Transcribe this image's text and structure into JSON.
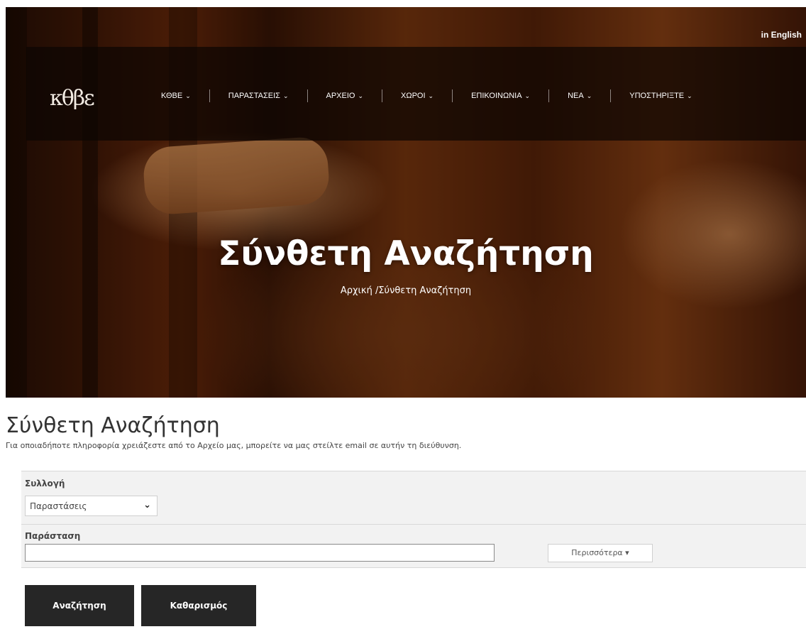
{
  "header": {
    "language_link": "in English",
    "logo_text": "κθβε",
    "nav": [
      {
        "label": "ΚΘΒΕ",
        "chevron": "⌄"
      },
      {
        "label": "ΠΑΡΑΣΤΑΣΕΙΣ",
        "chevron": "⌄"
      },
      {
        "label": "ΑΡΧΕΙΟ",
        "chevron": "⌄"
      },
      {
        "label": "ΧΩΡΟΙ",
        "chevron": "⌄"
      },
      {
        "label": "ΕΠΙΚΟΙΝΩΝΙΑ",
        "chevron": "⌄"
      },
      {
        "label": "ΝΕΑ",
        "chevron": "⌄"
      },
      {
        "label": "ΥΠΟΣΤΗΡΙΞΤΕ",
        "chevron": "⌄"
      }
    ]
  },
  "hero": {
    "title": "Σύνθετη Αναζήτηση",
    "breadcrumb": "Αρχική /Σύνθετη Αναζήτηση"
  },
  "main": {
    "title": "Σύνθετη Αναζήτηση",
    "intro": "Για οποιαδήποτε πληροφορία χρειάζεστε από το Αρχείο μας, μπορείτε να μας στείλτε email σε αυτήν τη διεύθυνση.",
    "collection_label": "Συλλογή",
    "collection_selected": "Παραστάσεις",
    "collection_chevron": "⌄",
    "show_label": "Παράσταση",
    "show_value": "",
    "more_label": "Περισσότερα ▾",
    "search_button": "Αναζήτηση",
    "clear_button": "Καθαρισμός"
  }
}
